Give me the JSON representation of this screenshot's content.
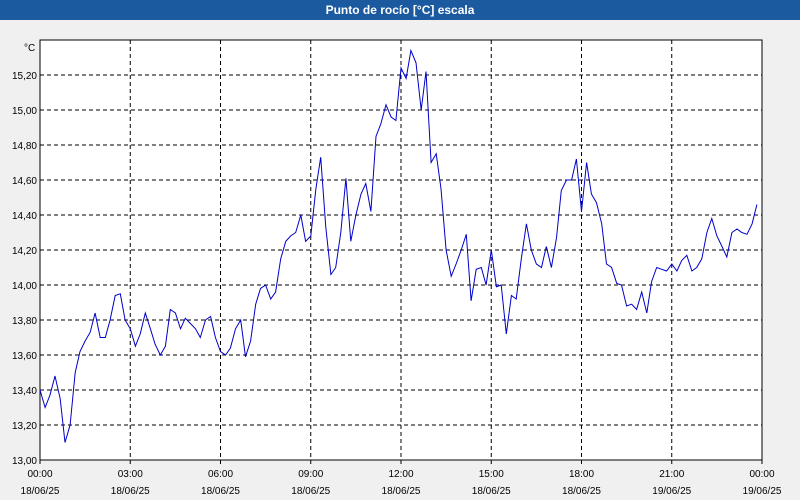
{
  "window": {
    "title": "Punto de rocío [°C] escala"
  },
  "colors": {
    "title_bar": "#1c5aa0",
    "line": "#0000c8",
    "grid": "#000000",
    "plot_bg": "#ffffff"
  },
  "chart_data": {
    "type": "line",
    "title": "Punto de rocío [°C] escala",
    "ylabel": "°C",
    "xlabel": "",
    "ylim": [
      13.0,
      15.4
    ],
    "xlim_hours": [
      0,
      24
    ],
    "grid": true,
    "y_ticks": [
      "13,00",
      "13,20",
      "13,40",
      "13,60",
      "13,80",
      "14,00",
      "14,20",
      "14,40",
      "14,60",
      "14,80",
      "15,00",
      "15,20"
    ],
    "x_ticks": [
      {
        "time": "00:00",
        "date": "18/06/25"
      },
      {
        "time": "03:00",
        "date": "18/06/25"
      },
      {
        "time": "06:00",
        "date": "18/06/25"
      },
      {
        "time": "09:00",
        "date": "18/06/25"
      },
      {
        "time": "12:00",
        "date": "18/06/25"
      },
      {
        "time": "15:00",
        "date": "18/06/25"
      },
      {
        "time": "18:00",
        "date": "18/06/25"
      },
      {
        "time": "21:00",
        "date": "19/06/25"
      },
      {
        "time": "00:00",
        "date": "19/06/25"
      }
    ],
    "series": [
      {
        "x_hours": [
          0,
          0.17,
          0.33,
          0.5,
          0.67,
          0.83,
          1.0,
          1.17,
          1.33,
          1.5,
          1.67,
          1.83,
          2.0,
          2.17,
          2.33,
          2.5,
          2.67,
          2.83,
          3.0,
          3.17,
          3.33,
          3.5,
          3.67,
          3.83,
          4.0,
          4.17,
          4.33,
          4.5,
          4.67,
          4.83,
          5.0,
          5.17,
          5.33,
          5.5,
          5.67,
          5.83,
          6.0,
          6.17,
          6.33,
          6.5,
          6.67,
          6.83,
          7.0,
          7.17,
          7.33,
          7.5,
          7.67,
          7.83,
          8.0,
          8.17,
          8.33,
          8.5,
          8.67,
          8.83,
          9.0,
          9.17,
          9.33,
          9.5,
          9.67,
          9.83,
          10.0,
          10.17,
          10.33,
          10.5,
          10.67,
          10.83,
          11.0,
          11.17,
          11.33,
          11.5,
          11.67,
          11.83,
          12.0,
          12.17,
          12.33,
          12.5,
          12.67,
          12.83,
          13.0,
          13.17,
          13.33,
          13.5,
          13.67,
          13.83,
          14.0,
          14.17,
          14.33,
          14.5,
          14.67,
          14.83,
          15.0,
          15.17,
          15.33,
          15.5,
          15.67,
          15.83,
          16.0,
          16.17,
          16.33,
          16.5,
          16.67,
          16.83,
          17.0,
          17.17,
          17.33,
          17.5,
          17.67,
          17.83,
          18.0,
          18.17,
          18.33,
          18.5,
          18.67,
          18.83,
          19.0,
          19.17,
          19.33,
          19.5,
          19.67,
          19.83,
          20.0,
          20.17,
          20.33,
          20.5,
          20.67,
          20.83,
          21.0,
          21.17,
          21.33,
          21.5,
          21.67,
          21.83,
          22.0,
          22.17,
          22.33,
          22.5,
          22.67,
          22.83,
          23.0,
          23.17,
          23.33,
          23.5,
          23.67,
          23.83,
          24.0
        ],
        "values": [
          13.4,
          13.3,
          13.37,
          13.48,
          13.35,
          13.1,
          13.2,
          13.5,
          13.62,
          13.68,
          13.73,
          13.84,
          13.7,
          13.7,
          13.8,
          13.94,
          13.95,
          13.8,
          13.75,
          13.65,
          13.72,
          13.84,
          13.75,
          13.66,
          13.6,
          13.65,
          13.86,
          13.84,
          13.75,
          13.81,
          13.78,
          13.75,
          13.7,
          13.8,
          13.82,
          13.7,
          13.62,
          13.6,
          13.64,
          13.75,
          13.8,
          13.59,
          13.68,
          13.89,
          13.98,
          14.0,
          13.92,
          13.96,
          14.15,
          14.25,
          14.28,
          14.3,
          14.4,
          14.25,
          14.28,
          14.55,
          14.73,
          14.33,
          14.06,
          14.1,
          14.3,
          14.61,
          14.25,
          14.4,
          14.52,
          14.58,
          14.42,
          14.85,
          14.92,
          15.03,
          14.96,
          14.94,
          15.24,
          15.18,
          15.34,
          15.27,
          15.0,
          15.22,
          14.7,
          14.75,
          14.55,
          14.2,
          14.05,
          14.12,
          14.2,
          14.29,
          13.91,
          14.09,
          14.1,
          14.0,
          14.2,
          13.99,
          14.0,
          13.72,
          13.94,
          13.92,
          14.15,
          14.35,
          14.2,
          14.12,
          14.1,
          14.22,
          14.1,
          14.27,
          14.54,
          14.6,
          14.6,
          14.72,
          14.42,
          14.7,
          14.52,
          14.47,
          14.35,
          14.12,
          14.1,
          14.01,
          14.0,
          13.88,
          13.89,
          13.86,
          13.96,
          13.84,
          14.02,
          14.1,
          14.09,
          14.08,
          14.12,
          14.08,
          14.14,
          14.17,
          14.08,
          14.1,
          14.15,
          14.3,
          14.38,
          14.28,
          14.22,
          14.16,
          14.3,
          14.32,
          14.3,
          14.29,
          14.35,
          14.46
        ]
      }
    ]
  }
}
